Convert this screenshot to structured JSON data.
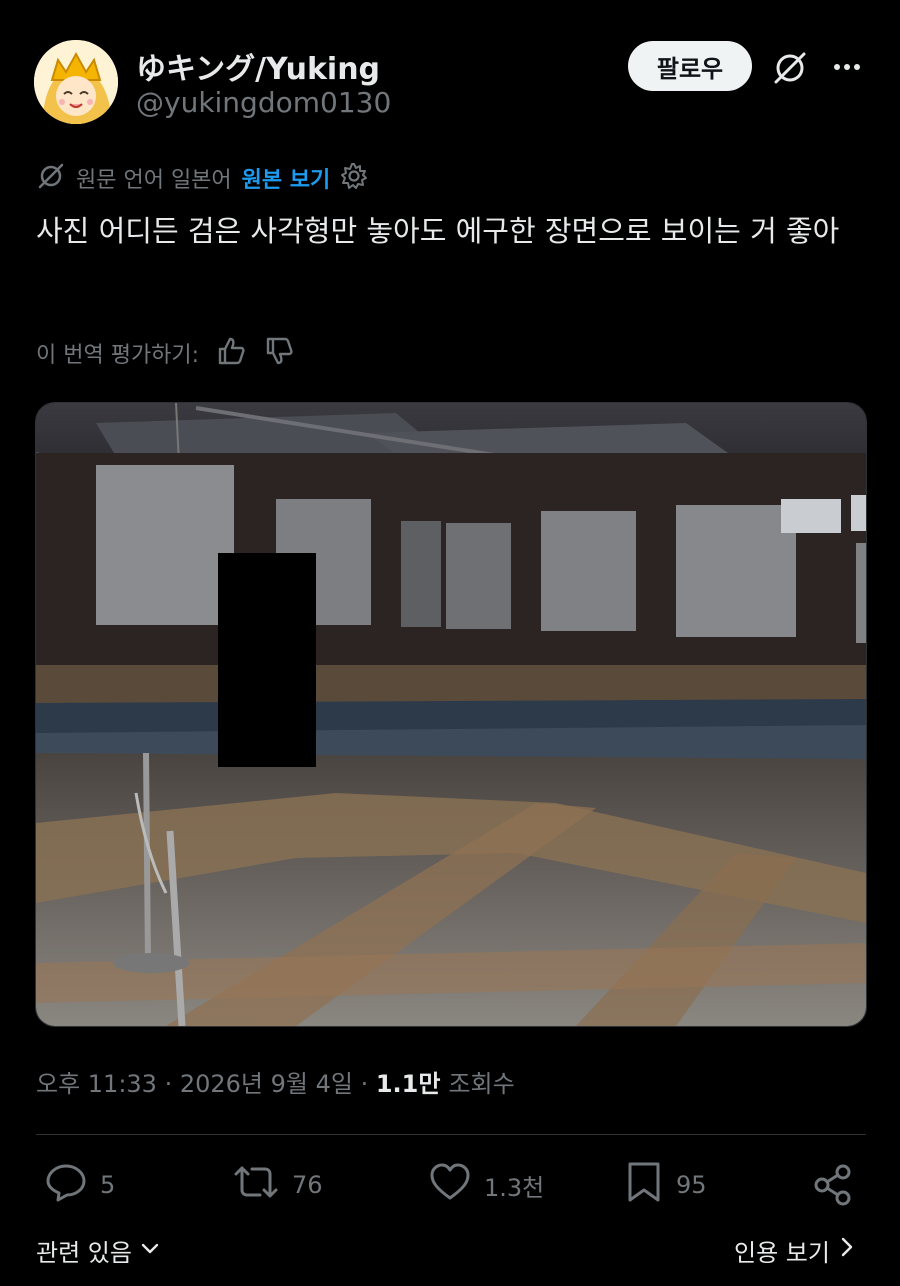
{
  "author": {
    "display_name": "ゆキング/Yuking",
    "handle": "@yukingdom0130"
  },
  "header": {
    "follow_label": "팔로우",
    "grok_icon": "grok-icon",
    "more_icon": "more-icon"
  },
  "translation": {
    "source_label": "원문 언어 일본어",
    "view_original_label": "원본 보기",
    "rate_label": "이 번역 평가하기:"
  },
  "tweet": {
    "text": "사진 어디든 검은 사각형만 놓아도 에구한 장면으로 보이는 거 좋아"
  },
  "meta": {
    "time": "오후 11:33 · 2026년 9월 4일 · ",
    "views_count": "1.1만",
    "views_label": "조회수"
  },
  "actions": {
    "replies": "5",
    "retweets": "76",
    "likes": "1.3천",
    "bookmarks": "95"
  },
  "footer": {
    "related_label": "관련 있음",
    "quotes_label": "인용 보기"
  },
  "colors": {
    "background": "#000000",
    "text": "#e7e9ea",
    "muted": "#71767b",
    "accent": "#1d9bf0",
    "divider": "#2f3336"
  }
}
